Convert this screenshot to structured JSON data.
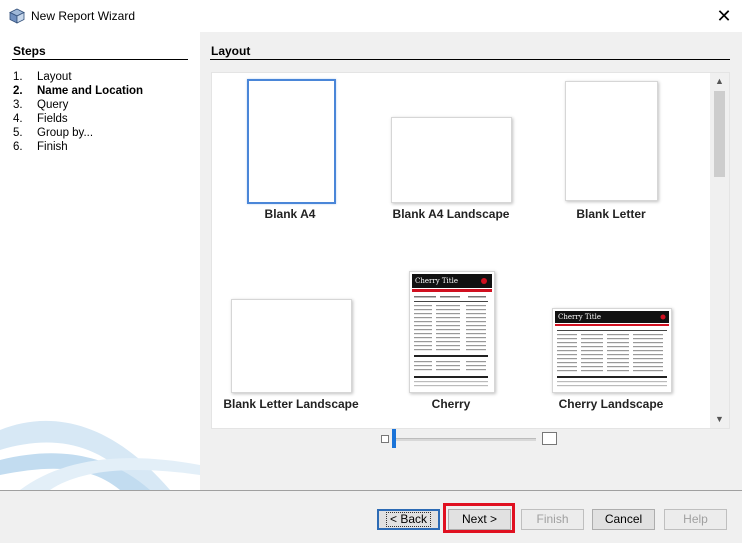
{
  "window": {
    "title": "New Report Wizard",
    "icon": "app-cube-icon",
    "close_icon": "close-icon",
    "close_glyph": "✕"
  },
  "steps": {
    "title": "Steps",
    "items": [
      {
        "number": "1.",
        "label": "Layout"
      },
      {
        "number": "2.",
        "label": "Name and Location",
        "current": true
      },
      {
        "number": "3.",
        "label": "Query"
      },
      {
        "number": "4.",
        "label": "Fields"
      },
      {
        "number": "5.",
        "label": "Group by..."
      },
      {
        "number": "6.",
        "label": "Finish"
      }
    ]
  },
  "layout": {
    "title": "Layout",
    "templates": [
      {
        "label": "Blank A4",
        "selected": true
      },
      {
        "label": "Blank A4 Landscape"
      },
      {
        "label": "Blank Letter"
      },
      {
        "label": "Blank Letter Landscape"
      },
      {
        "label": "Cherry"
      },
      {
        "label": "Cherry Landscape"
      }
    ],
    "thumbnail_text": {
      "cherry_title": "Cherry Title",
      "cherry_subtitle": "Cherry SubTitle"
    }
  },
  "buttons": {
    "back": "< Back",
    "next": "Next >",
    "finish": "Finish",
    "cancel": "Cancel",
    "help": "Help"
  },
  "colors": {
    "accent": "#4a86d8",
    "highlight": "#e01020",
    "cherry_red": "#d01020"
  }
}
